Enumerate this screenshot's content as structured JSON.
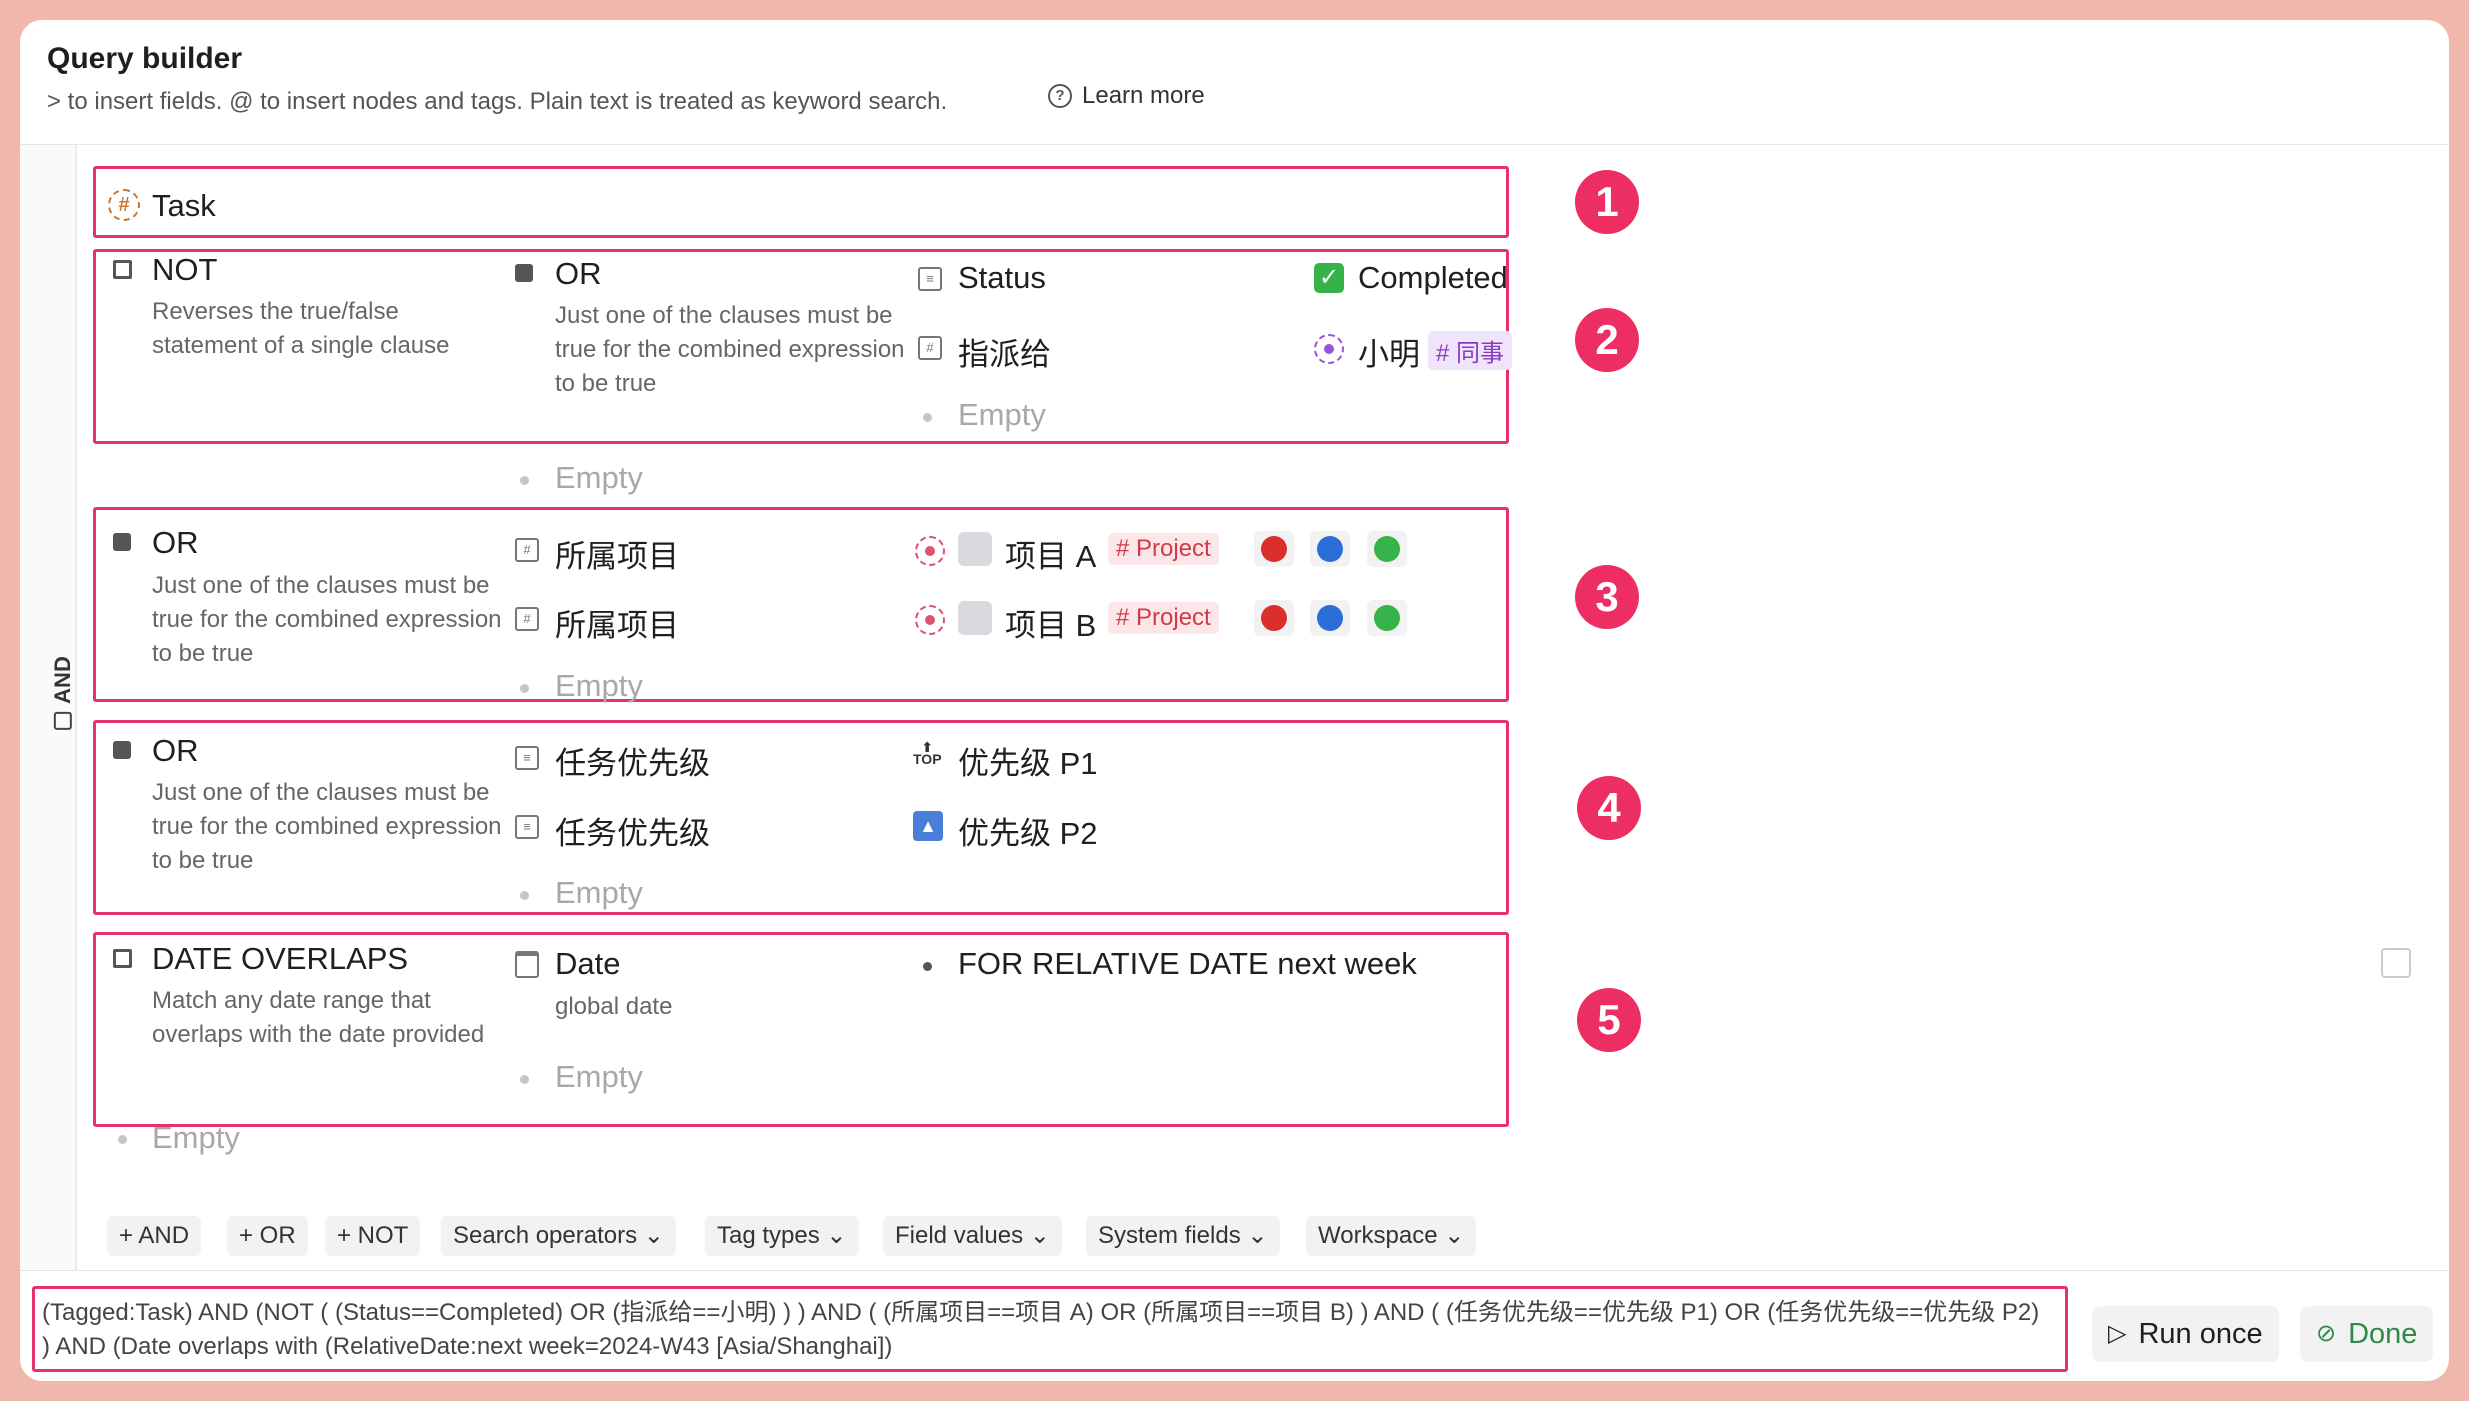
{
  "header": {
    "title": "Query builder",
    "subtitle": "> to insert fields. @ to insert nodes and tags. Plain text is treated as keyword search.",
    "learn_more": "Learn more"
  },
  "root_operator": "AND",
  "blocks": {
    "b1": {
      "badge": "1",
      "tag": "Task"
    },
    "b2": {
      "badge": "2",
      "op": "NOT",
      "op_desc": "Reverses the true/false statement of a single clause",
      "inner_op": "OR",
      "inner_desc": "Just one of the clauses must be true for the combined expression to be true",
      "field1": "Status",
      "value1": "Completed",
      "field2": "指派给",
      "value2": "小明",
      "value2_tag": "# 同事",
      "empty_inner": "Empty",
      "empty_outer": "Empty"
    },
    "b3": {
      "badge": "3",
      "op": "OR",
      "op_desc": "Just one of the clauses must be true for the combined expression to be true",
      "field1": "所属项目",
      "value1": "项目 A",
      "value1_tag": "# Project",
      "field2": "所属项目",
      "value2": "项目 B",
      "value2_tag": "# Project",
      "empty": "Empty"
    },
    "b4": {
      "badge": "4",
      "op": "OR",
      "op_desc": "Just one of the clauses must be true for the combined expression to be true",
      "field1": "任务优先级",
      "value1": "优先级 P1",
      "field2": "任务优先级",
      "value2": "优先级 P2",
      "empty": "Empty"
    },
    "b5": {
      "badge": "5",
      "op": "DATE OVERLAPS",
      "op_desc": "Match any date range that overlaps with the date provided",
      "field": "Date",
      "field_sub": "global date",
      "value": "FOR RELATIVE DATE next week",
      "empty": "Empty"
    },
    "trailing_empty": "Empty"
  },
  "toolbar": {
    "and": "+ AND",
    "or": "+ OR",
    "not": "+ NOT",
    "search_operators": "Search operators ⌄",
    "tag_types": "Tag types ⌄",
    "field_values": "Field values ⌄",
    "system_fields": "System fields ⌄",
    "workspace": "Workspace ⌄"
  },
  "expression": "(Tagged:Task) AND (NOT ( (Status==Completed) OR (指派给==小明) ) ) AND ( (所属项目==项目 A) OR (所属项目==项目 B) ) AND ( (任务优先级==优先级 P1) OR (任务优先级==优先级 P2) ) AND (Date overlaps with (RelativeDate:next week=2024-W43 [Asia/Shanghai])",
  "actions": {
    "run_once": "Run once",
    "done": "Done"
  },
  "colors": {
    "highlight": "#e5326a",
    "badge": "#ec2e63",
    "background": "#f0b8ac",
    "red_ball": "#d9302c",
    "blue_ball": "#2b6fd6",
    "green_ball": "#38b24a"
  },
  "icons": {
    "tag": "hash-icon",
    "and": "and-square-icon",
    "not": "not-square-icon",
    "or": "or-square-icon",
    "field": "field-icon",
    "check": "check-icon",
    "priority_p1": "top-arrow-icon",
    "priority_p2": "triangle-up-icon",
    "date": "calendar-icon",
    "run": "play-icon",
    "done": "check-circle-icon"
  }
}
